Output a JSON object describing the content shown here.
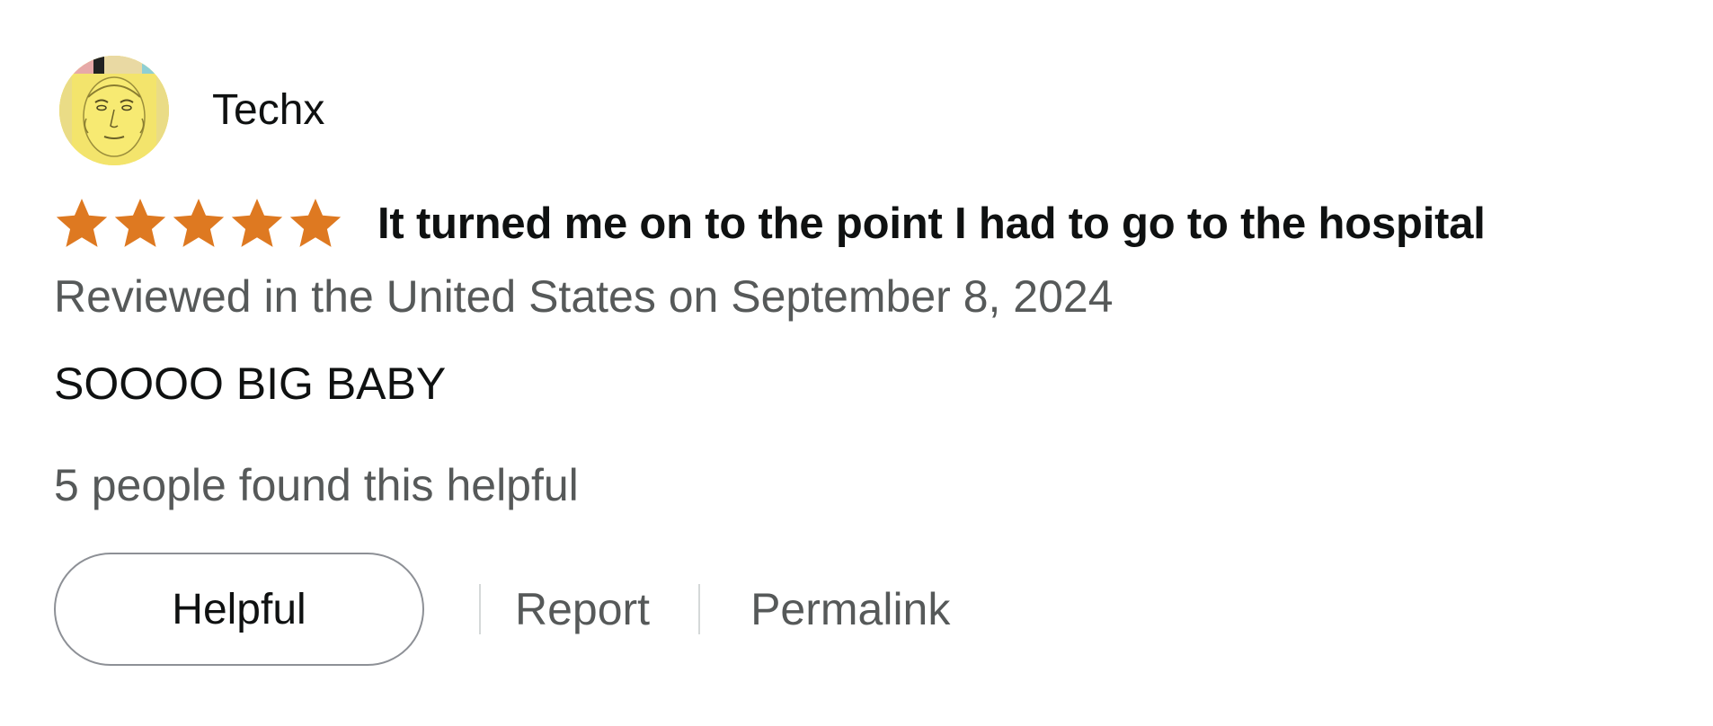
{
  "reviewer": {
    "name": "Techx",
    "avatar_icon": "reviewer-avatar"
  },
  "rating": {
    "stars": 5,
    "max": 5,
    "star_icon": "star-icon",
    "star_color": "#de7921"
  },
  "review": {
    "title": "It turned me on to the point I had to go to the hospital",
    "date_line": "Reviewed in the United States on September 8, 2024",
    "body": "SOOOO BIG BABY",
    "helpful_count_text": "5 people found this helpful"
  },
  "actions": {
    "helpful_label": "Helpful",
    "report_label": "Report",
    "permalink_label": "Permalink"
  },
  "colors": {
    "text_primary": "#0f1111",
    "text_secondary": "#565959",
    "button_border": "#8d9096",
    "divider": "#d5d9d9"
  }
}
